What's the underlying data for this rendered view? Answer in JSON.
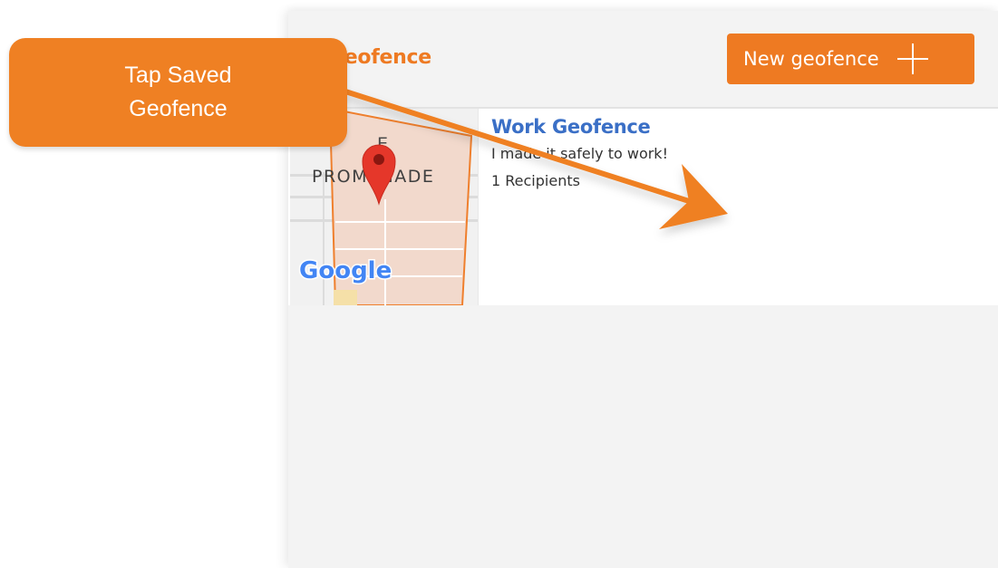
{
  "header": {
    "title": "Geofence",
    "new_button_label": "New geofence"
  },
  "geofences": [
    {
      "name": "Work Geofence",
      "message": "I made it safely to work!",
      "recipients": "1 Recipients",
      "map": {
        "place_label": "PROMENADE",
        "partial_label": "E",
        "logo_text": "Google"
      }
    }
  ],
  "tutorial": {
    "callout_line1": "Tap Saved",
    "callout_line2": "Geofence"
  },
  "colors": {
    "accent": "#ee7a22",
    "callout": "#ef8023",
    "link_blue": "#3a6fc6",
    "panel_bg": "#f3f3f3",
    "map_fill": "#f2d9cc",
    "pin_red": "#e5372a"
  },
  "icons": {
    "add": "plus-icon",
    "pin": "map-pin-icon",
    "logo": "google-logo-icon"
  }
}
